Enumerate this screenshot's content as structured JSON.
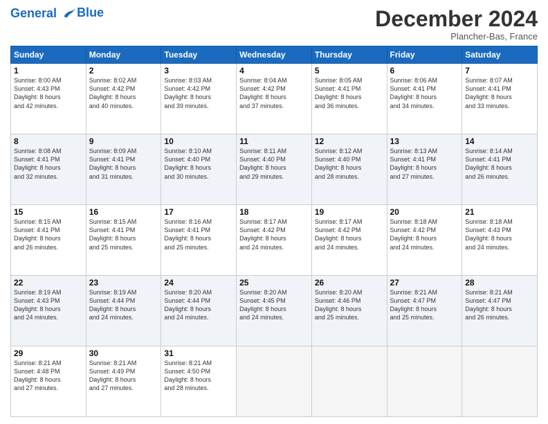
{
  "header": {
    "logo_line1": "General",
    "logo_line2": "Blue",
    "month": "December 2024",
    "location": "Plancher-Bas, France"
  },
  "weekdays": [
    "Sunday",
    "Monday",
    "Tuesday",
    "Wednesday",
    "Thursday",
    "Friday",
    "Saturday"
  ],
  "weeks": [
    [
      {
        "day": "1",
        "lines": [
          "Sunrise: 8:00 AM",
          "Sunset: 4:43 PM",
          "Daylight: 8 hours",
          "and 42 minutes."
        ]
      },
      {
        "day": "2",
        "lines": [
          "Sunrise: 8:02 AM",
          "Sunset: 4:42 PM",
          "Daylight: 8 hours",
          "and 40 minutes."
        ]
      },
      {
        "day": "3",
        "lines": [
          "Sunrise: 8:03 AM",
          "Sunset: 4:42 PM",
          "Daylight: 8 hours",
          "and 39 minutes."
        ]
      },
      {
        "day": "4",
        "lines": [
          "Sunrise: 8:04 AM",
          "Sunset: 4:42 PM",
          "Daylight: 8 hours",
          "and 37 minutes."
        ]
      },
      {
        "day": "5",
        "lines": [
          "Sunrise: 8:05 AM",
          "Sunset: 4:41 PM",
          "Daylight: 8 hours",
          "and 36 minutes."
        ]
      },
      {
        "day": "6",
        "lines": [
          "Sunrise: 8:06 AM",
          "Sunset: 4:41 PM",
          "Daylight: 8 hours",
          "and 34 minutes."
        ]
      },
      {
        "day": "7",
        "lines": [
          "Sunrise: 8:07 AM",
          "Sunset: 4:41 PM",
          "Daylight: 8 hours",
          "and 33 minutes."
        ]
      }
    ],
    [
      {
        "day": "8",
        "lines": [
          "Sunrise: 8:08 AM",
          "Sunset: 4:41 PM",
          "Daylight: 8 hours",
          "and 32 minutes."
        ]
      },
      {
        "day": "9",
        "lines": [
          "Sunrise: 8:09 AM",
          "Sunset: 4:41 PM",
          "Daylight: 8 hours",
          "and 31 minutes."
        ]
      },
      {
        "day": "10",
        "lines": [
          "Sunrise: 8:10 AM",
          "Sunset: 4:40 PM",
          "Daylight: 8 hours",
          "and 30 minutes."
        ]
      },
      {
        "day": "11",
        "lines": [
          "Sunrise: 8:11 AM",
          "Sunset: 4:40 PM",
          "Daylight: 8 hours",
          "and 29 minutes."
        ]
      },
      {
        "day": "12",
        "lines": [
          "Sunrise: 8:12 AM",
          "Sunset: 4:40 PM",
          "Daylight: 8 hours",
          "and 28 minutes."
        ]
      },
      {
        "day": "13",
        "lines": [
          "Sunrise: 8:13 AM",
          "Sunset: 4:41 PM",
          "Daylight: 8 hours",
          "and 27 minutes."
        ]
      },
      {
        "day": "14",
        "lines": [
          "Sunrise: 8:14 AM",
          "Sunset: 4:41 PM",
          "Daylight: 8 hours",
          "and 26 minutes."
        ]
      }
    ],
    [
      {
        "day": "15",
        "lines": [
          "Sunrise: 8:15 AM",
          "Sunset: 4:41 PM",
          "Daylight: 8 hours",
          "and 26 minutes."
        ]
      },
      {
        "day": "16",
        "lines": [
          "Sunrise: 8:15 AM",
          "Sunset: 4:41 PM",
          "Daylight: 8 hours",
          "and 25 minutes."
        ]
      },
      {
        "day": "17",
        "lines": [
          "Sunrise: 8:16 AM",
          "Sunset: 4:41 PM",
          "Daylight: 8 hours",
          "and 25 minutes."
        ]
      },
      {
        "day": "18",
        "lines": [
          "Sunrise: 8:17 AM",
          "Sunset: 4:42 PM",
          "Daylight: 8 hours",
          "and 24 minutes."
        ]
      },
      {
        "day": "19",
        "lines": [
          "Sunrise: 8:17 AM",
          "Sunset: 4:42 PM",
          "Daylight: 8 hours",
          "and 24 minutes."
        ]
      },
      {
        "day": "20",
        "lines": [
          "Sunrise: 8:18 AM",
          "Sunset: 4:42 PM",
          "Daylight: 8 hours",
          "and 24 minutes."
        ]
      },
      {
        "day": "21",
        "lines": [
          "Sunrise: 8:18 AM",
          "Sunset: 4:43 PM",
          "Daylight: 8 hours",
          "and 24 minutes."
        ]
      }
    ],
    [
      {
        "day": "22",
        "lines": [
          "Sunrise: 8:19 AM",
          "Sunset: 4:43 PM",
          "Daylight: 8 hours",
          "and 24 minutes."
        ]
      },
      {
        "day": "23",
        "lines": [
          "Sunrise: 8:19 AM",
          "Sunset: 4:44 PM",
          "Daylight: 8 hours",
          "and 24 minutes."
        ]
      },
      {
        "day": "24",
        "lines": [
          "Sunrise: 8:20 AM",
          "Sunset: 4:44 PM",
          "Daylight: 8 hours",
          "and 24 minutes."
        ]
      },
      {
        "day": "25",
        "lines": [
          "Sunrise: 8:20 AM",
          "Sunset: 4:45 PM",
          "Daylight: 8 hours",
          "and 24 minutes."
        ]
      },
      {
        "day": "26",
        "lines": [
          "Sunrise: 8:20 AM",
          "Sunset: 4:46 PM",
          "Daylight: 8 hours",
          "and 25 minutes."
        ]
      },
      {
        "day": "27",
        "lines": [
          "Sunrise: 8:21 AM",
          "Sunset: 4:47 PM",
          "Daylight: 8 hours",
          "and 25 minutes."
        ]
      },
      {
        "day": "28",
        "lines": [
          "Sunrise: 8:21 AM",
          "Sunset: 4:47 PM",
          "Daylight: 8 hours",
          "and 26 minutes."
        ]
      }
    ],
    [
      {
        "day": "29",
        "lines": [
          "Sunrise: 8:21 AM",
          "Sunset: 4:48 PM",
          "Daylight: 8 hours",
          "and 27 minutes."
        ]
      },
      {
        "day": "30",
        "lines": [
          "Sunrise: 8:21 AM",
          "Sunset: 4:49 PM",
          "Daylight: 8 hours",
          "and 27 minutes."
        ]
      },
      {
        "day": "31",
        "lines": [
          "Sunrise: 8:21 AM",
          "Sunset: 4:50 PM",
          "Daylight: 8 hours",
          "and 28 minutes."
        ]
      },
      null,
      null,
      null,
      null
    ]
  ]
}
